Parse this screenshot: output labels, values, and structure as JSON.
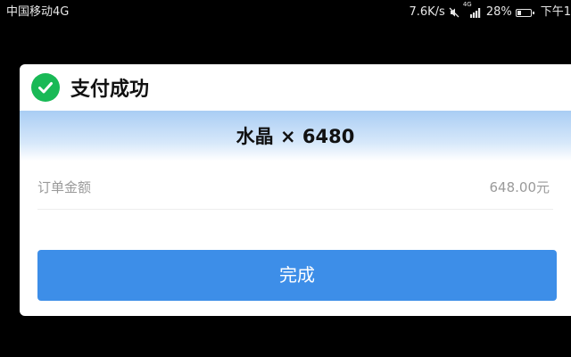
{
  "status_bar": {
    "carrier": "中国移动4G",
    "speed": "7.6K/s",
    "network_badge": "4G",
    "battery": "28%",
    "battery_level": 0.28,
    "time": "下午1",
    "icons": [
      "mute-icon",
      "signal-icon",
      "battery-icon"
    ]
  },
  "dialog": {
    "title": "支付成功",
    "success_icon": "check-circle-icon",
    "success_color": "#19b956",
    "product": "水晶 × 6480",
    "order": {
      "label": "订单金额",
      "value": "648.00元"
    },
    "done_button": {
      "label": "完成",
      "color": "#3d8ee8"
    }
  }
}
